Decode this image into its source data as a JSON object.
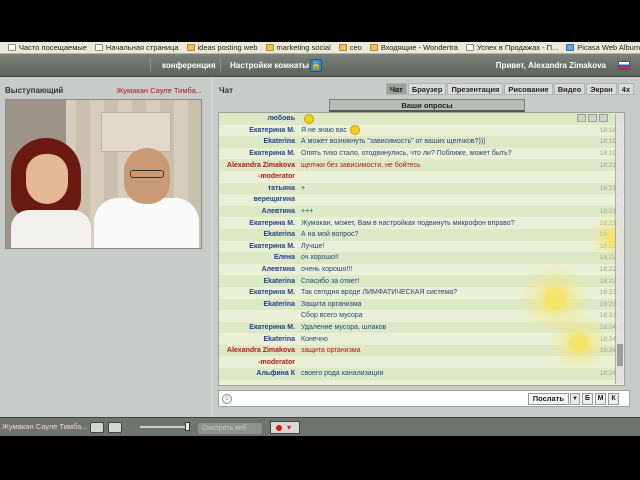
{
  "bookmarks": [
    {
      "label": "Часто посещаемые",
      "icon": "page-icon"
    },
    {
      "label": "Начальная страница",
      "icon": "page-icon"
    },
    {
      "label": "ideas posting web",
      "icon": "folder-icon"
    },
    {
      "label": "marketing social",
      "icon": "folder-icon"
    },
    {
      "label": "ceo",
      "icon": "folder-icon"
    },
    {
      "label": "Входящие - Wondertra",
      "icon": "folder-icon"
    },
    {
      "label": "Успех в Продажах - П...",
      "icon": "page-icon"
    },
    {
      "label": "Picasa Web Albums - ...",
      "icon": "picture-icon"
    }
  ],
  "topbar": {
    "conference": "конференция",
    "room_settings": "Настройки комнаты",
    "greeting": "Привет, Alexandra Zimakova"
  },
  "left": {
    "heading": "Выступающий",
    "speaker_name": "Жумакан Сауле  Тимба..."
  },
  "chat": {
    "heading": "Чат",
    "tabs": [
      "Чат",
      "Браузер",
      "Презентация",
      "Рисование",
      "Видео",
      "Экран",
      "4х"
    ],
    "active_tab": "Чат",
    "polls_label": "Ваши опросы",
    "messages": [
      {
        "nick": "любовь",
        "text": "",
        "time": "",
        "mod": false,
        "smile": true
      },
      {
        "nick": "Екатерина М.",
        "text": "Я не знаю вас",
        "time": "18:18",
        "mod": false,
        "smile": true
      },
      {
        "nick": "Ekaterina",
        "text": "А может возникнуть \"зависимость\" от ваших щелчков?)))",
        "time": "18:19",
        "mod": false
      },
      {
        "nick": "Екатерина М.",
        "text": "Опять тихо стало, отодвинулись, что ли? Поближе, может быть?",
        "time": "18:19",
        "mod": false
      },
      {
        "nick": "Alexandra Zimakova",
        "text": "щелчки без зависимости, не бойтесь",
        "time": "18:21",
        "mod": true
      },
      {
        "nick": "-moderator",
        "text": "",
        "time": "",
        "mod": true
      },
      {
        "nick": "татьяна",
        "text": "+",
        "time": "18:21",
        "mod": false
      },
      {
        "nick": "верещагина",
        "text": "",
        "time": "",
        "mod": false
      },
      {
        "nick": "Алевтина",
        "text": "+++",
        "time": "18:21",
        "mod": false
      },
      {
        "nick": "Екатерина М.",
        "text": "Жумакан, может, Вам в настройках подвинуть микрофон вправо?",
        "time": "18:21",
        "mod": false
      },
      {
        "nick": "Ekaterina",
        "text": "А на мой вопрос?",
        "time": "18:21",
        "mod": false
      },
      {
        "nick": "Екатерина М.",
        "text": "Лучше!",
        "time": "18:22",
        "mod": false
      },
      {
        "nick": "Елена",
        "text": "оч хорошо!!",
        "time": "18:22",
        "mod": false
      },
      {
        "nick": "Алевтина",
        "text": "очень хорошо!!!",
        "time": "18:22",
        "mod": false
      },
      {
        "nick": "Ekaterina",
        "text": "Спасибо за ответ!",
        "time": "18:22",
        "mod": false
      },
      {
        "nick": "Екатерина М.",
        "text": "Так сегодня вроде ЛИМФАТИЧЕСКАЯ система?",
        "time": "18:23",
        "mod": false
      },
      {
        "nick": "Ekaterina",
        "text": "Защита организма",
        "time": "18:23",
        "mod": false
      },
      {
        "nick": "",
        "text": "Сбор всего мусора",
        "time": "18:23",
        "mod": false
      },
      {
        "nick": "Екатерина М.",
        "text": "Удаление мусора, шлаков",
        "time": "18:24",
        "mod": false
      },
      {
        "nick": "Ekaterina",
        "text": "Конечно",
        "time": "18:24",
        "mod": false
      },
      {
        "nick": "Alexandra Zimakova",
        "text": "защита организма",
        "time": "18:24",
        "mod": true
      },
      {
        "nick": "-moderator",
        "text": "",
        "time": "",
        "mod": true
      },
      {
        "nick": "Альфина К",
        "text": "своего рода канализация",
        "time": "18:24",
        "mod": false
      }
    ],
    "send_label": "Послать",
    "fmt_buttons": [
      "Б",
      "М",
      "К"
    ]
  },
  "bottombar": {
    "speaker_name": "Жумакан Сауле  Тимба...",
    "ghost_label": "Смотреть веб"
  },
  "colors": {
    "moderator": "#b01818",
    "nick": "#213f8a",
    "chat_bg": "#e9f0d5"
  }
}
